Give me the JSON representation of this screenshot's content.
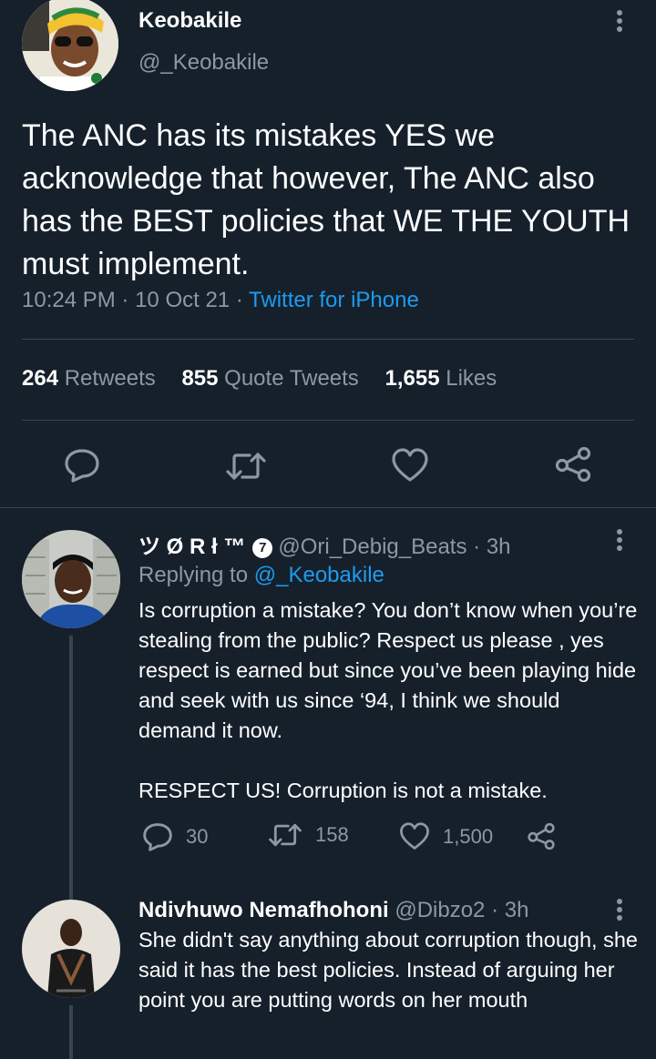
{
  "main_tweet": {
    "author_name": "Keobakile",
    "author_handle": "@_Keobakile",
    "text": "The ANC has its mistakes YES we acknowledge that however, The ANC also has the BEST policies that WE THE YOUTH must implement.",
    "time": "10:24 PM",
    "date": "10 Oct 21",
    "source": "Twitter for iPhone",
    "separator": "·",
    "stats": {
      "retweets_count": "264",
      "retweets_label": "Retweets",
      "quotes_count": "855",
      "quotes_label": "Quote Tweets",
      "likes_count": "1,655",
      "likes_label": "Likes"
    },
    "actions": [
      "reply-icon",
      "retweet-icon",
      "like-icon",
      "share-icon"
    ]
  },
  "replies": [
    {
      "author_name": "ツ Ø R ł ™",
      "badge": "7",
      "author_handle": "@Ori_Debig_Beats",
      "time": "· 3h",
      "replying_prefix": "Replying to",
      "replying_to": "@_Keobakile",
      "text_p1": "Is corruption a mistake? You don’t know when you’re stealing from the public? Respect us please , yes respect is earned but since you’ve been playing hide and seek with us since ‘94, I think we should demand it now.",
      "text_p2": "RESPECT US! Corruption is not a mistake.",
      "reply_count": "30",
      "retweet_count": "158",
      "like_count": "1,500"
    },
    {
      "author_name": "Ndivhuwo Nemafhohoni",
      "author_handle": "@Dibzo2",
      "time": "· 3h",
      "text_p1": "She didn't say anything about corruption though, she said it has the best policies. Instead of arguing her point you are putting words on her mouth"
    }
  ],
  "colors": {
    "background": "#15202b",
    "text": "#ffffff",
    "secondary": "#8b98a5",
    "accent": "#1d9bf0",
    "border": "#38444d"
  }
}
